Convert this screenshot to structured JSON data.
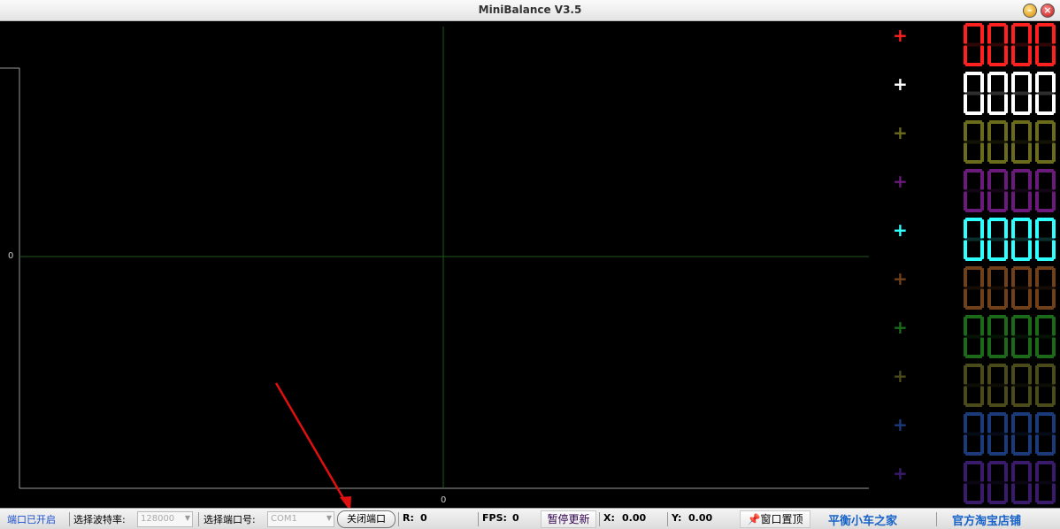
{
  "window": {
    "title": "MiniBalance V3.5"
  },
  "plot": {
    "y_axis_tick": "0",
    "x_axis_tick": "0"
  },
  "channels": [
    {
      "color": "#ff2020",
      "marker": "+",
      "display": "0000"
    },
    {
      "color": "#ffffff",
      "marker": "+",
      "display": "0000"
    },
    {
      "color": "#6b6b1c",
      "marker": "+",
      "display": "0000"
    },
    {
      "color": "#6a1a7a",
      "marker": "+",
      "display": "0000"
    },
    {
      "color": "#30ffff",
      "marker": "+",
      "display": "0000"
    },
    {
      "color": "#70401a",
      "marker": "+",
      "display": "0000"
    },
    {
      "color": "#1a6a1a",
      "marker": "+",
      "display": "0000"
    },
    {
      "color": "#4a4a1a",
      "marker": "+",
      "display": "0000"
    },
    {
      "color": "#1a3a7a",
      "marker": "+",
      "display": "0000"
    },
    {
      "color": "#3a1a6a",
      "marker": "+",
      "display": "0000"
    }
  ],
  "status": {
    "port_state": "端口已开启",
    "baud_label": "选择波特率:",
    "baud_value": "128000",
    "port_label": "选择端口号:",
    "port_value": "COM1",
    "close_port_button": "关闭端口",
    "r_label": "R:",
    "r_value": "0",
    "fps_label": "FPS:",
    "fps_value": "0",
    "pause_button": "暂停更新",
    "x_label": "X:",
    "x_value": "0.00",
    "y_label": "Y:",
    "y_value": "0.00",
    "pin_button": "窗口置顶",
    "home_link": "平衡小车之家",
    "shop_link": "官方淘宝店铺"
  },
  "annotation": {
    "arrow_color": "#e01010"
  }
}
